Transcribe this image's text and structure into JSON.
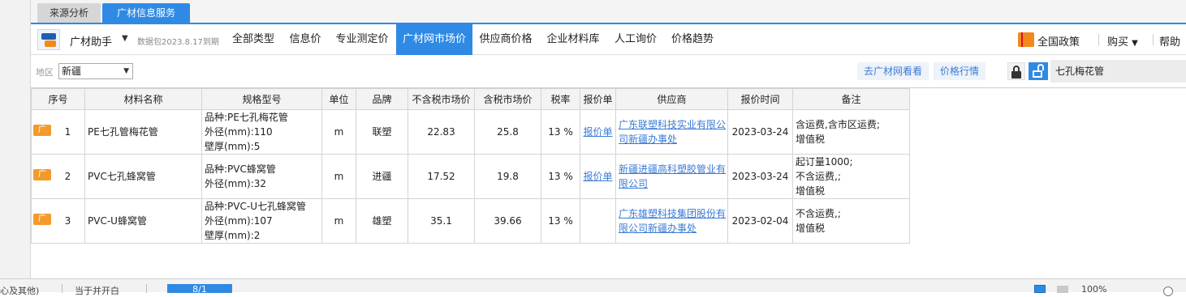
{
  "tabs": [
    "来源分析",
    "广材信息服务"
  ],
  "toolbar": {
    "brand": "广材助手",
    "package_info": "数据包2023.8.17到期",
    "menu": [
      "全部类型",
      "信息价",
      "专业测定价",
      "广材网市场价",
      "供应商价格",
      "企业材料库",
      "人工询价",
      "价格趋势"
    ],
    "active_menu": "广材网市场价",
    "policy": "全国政策",
    "buy": "购买",
    "help": "帮助"
  },
  "filter": {
    "region_label": "地区",
    "region_value": "新疆",
    "goto_site": "去广材网看看",
    "price_trend": "价格行情",
    "search_value": "七孔梅花管"
  },
  "table": {
    "headers": [
      "序号",
      "材料名称",
      "规格型号",
      "单位",
      "品牌",
      "不含税市场价",
      "含税市场价",
      "税率",
      "报价单",
      "供应商",
      "报价时间",
      "备注"
    ],
    "badge": "广",
    "rows": [
      {
        "no": "1",
        "name": "PE七孔管梅花管",
        "spec": [
          "品种:PE七孔梅花管",
          "外径(mm):110",
          "壁厚(mm):5"
        ],
        "unit": "m",
        "brand": "联塑",
        "price_ex": "22.83",
        "price_in": "25.8",
        "tax": "13 %",
        "quote": "报价单",
        "supplier": [
          "广东联塑科技实业有限公",
          "司新疆办事处"
        ],
        "date": "2023-03-24",
        "note": [
          "含运费,含市区运费;",
          "增值税"
        ]
      },
      {
        "no": "2",
        "name": "PVC七孔蜂窝管",
        "spec": [
          "品种:PVC蜂窝管",
          "外径(mm):32"
        ],
        "unit": "m",
        "brand": "进疆",
        "price_ex": "17.52",
        "price_in": "19.8",
        "tax": "13 %",
        "quote": "报价单",
        "supplier": [
          "新疆进疆高科塑胶管业有",
          "限公司"
        ],
        "date": "2023-03-24",
        "note": [
          "起订量1000;",
          "不含运费,;",
          "增值税"
        ]
      },
      {
        "no": "3",
        "name": "PVC-U蜂窝管",
        "spec": [
          "品种:PVC-U七孔蜂窝管",
          "外径(mm):107",
          "壁厚(mm):2"
        ],
        "unit": "m",
        "brand": "雄塑",
        "price_ex": "35.1",
        "price_in": "39.66",
        "tax": "13 %",
        "quote": "",
        "supplier": [
          "广东雄塑科技集团股份有",
          "限公司新疆办事处"
        ],
        "date": "2023-02-04",
        "note": [
          "不含运费,;",
          "增值税"
        ]
      }
    ]
  },
  "statusbar": {
    "left1": "心及其他)",
    "left2": "当于并开白",
    "active": "8/1",
    "zoom": "100%"
  }
}
